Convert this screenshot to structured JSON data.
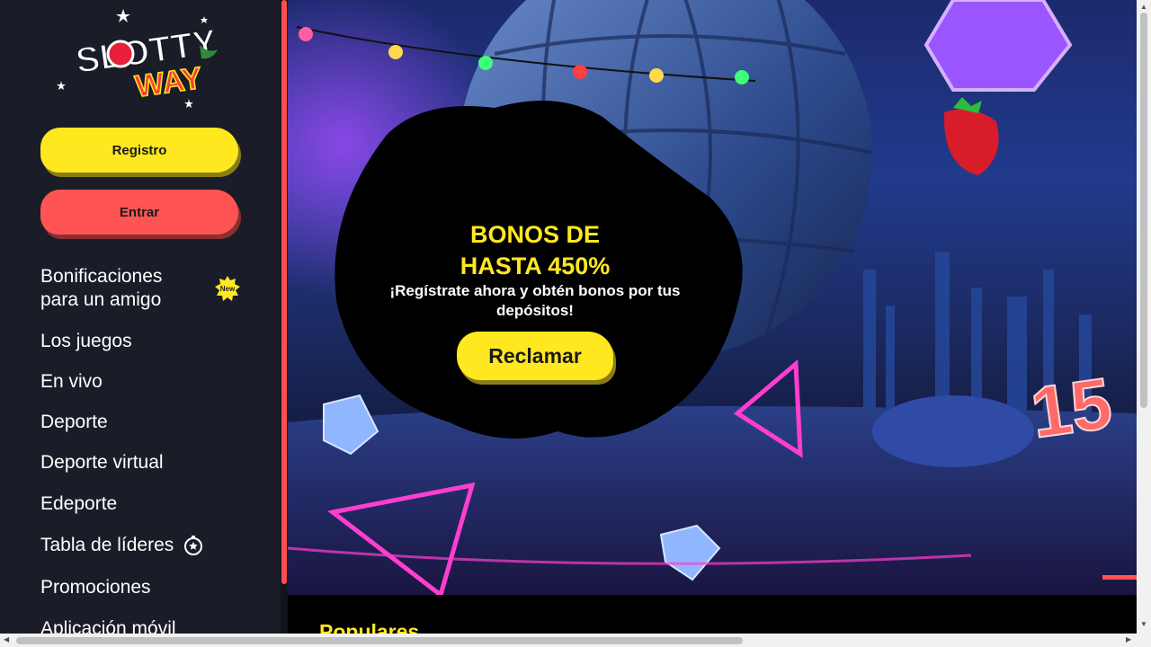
{
  "brand": {
    "logo_line1": "SLOTTY",
    "logo_line2": "WAY",
    "colors": {
      "yellow": "#ffe81f",
      "red": "#ff5454",
      "sidebar": "#1a1d27"
    }
  },
  "auth": {
    "register_label": "Registro",
    "login_label": "Entrar"
  },
  "nav": {
    "items": [
      {
        "label": "Bonificaciones para un amigo",
        "badge": "New"
      },
      {
        "label": "Los juegos"
      },
      {
        "label": "En vivo"
      },
      {
        "label": "Deporte"
      },
      {
        "label": "Deporte virtual"
      },
      {
        "label": "Edeporte"
      },
      {
        "label": "Tabla de líderes",
        "icon": "leaderboard-icon"
      },
      {
        "label": "Promociones"
      },
      {
        "label": "Aplicación móvil"
      }
    ]
  },
  "banner": {
    "title": "BONOS DE HASTA 450%",
    "subtitle": "¡Regístrate ahora y obtén bonos por tus depósitos!",
    "cta_label": "Reclamar",
    "neon_number": "15"
  },
  "section": {
    "title": "Populares"
  }
}
